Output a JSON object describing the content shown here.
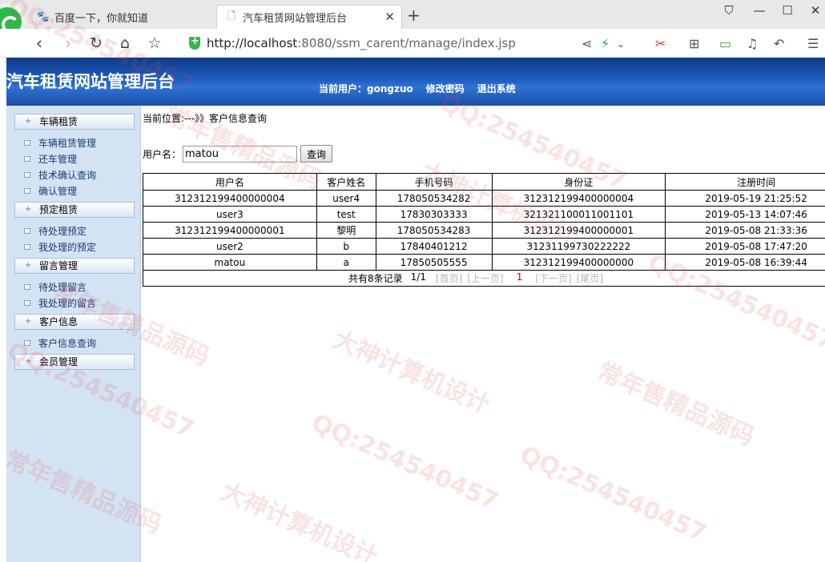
{
  "browser": {
    "tabs": [
      {
        "label": "百度一下，你就知道",
        "icon": "paw-icon"
      },
      {
        "label": "汽车租赁网站管理后台",
        "icon": "page-icon"
      }
    ],
    "url_host": "http://localhost",
    "url_path": ":8080/ssm_carent/manage/index.jsp"
  },
  "header": {
    "title": "汽车租赁网站管理后台",
    "current_user": "当前用户：gongzuo",
    "change_password": "修改密码",
    "logout": "退出系统"
  },
  "sidebar": {
    "categories": [
      {
        "label": "车辆租赁",
        "items": [
          "车辆租赁管理",
          "还车管理",
          "技术确认查询",
          "确认管理"
        ]
      },
      {
        "label": "预定租赁",
        "items": [
          "待处理预定",
          "我处理的预定"
        ]
      },
      {
        "label": "留言管理",
        "items": [
          "待处理留言",
          "我处理的留言"
        ]
      },
      {
        "label": "客户信息",
        "items": [
          "客户信息查询"
        ]
      },
      {
        "label": "会员管理",
        "items": []
      }
    ]
  },
  "main": {
    "breadcrumb": "当前位置:---》》客户信息查询",
    "search_label": "用户名：",
    "search_value": "matou",
    "search_button": "查询",
    "table": {
      "headers": [
        "用户名",
        "客户姓名",
        "手机号码",
        "身份证",
        "注册时间"
      ],
      "rows": [
        [
          "312312199400000004",
          "user4",
          "178050534282",
          "312312199400000004",
          "2019-05-19 21:25:52"
        ],
        [
          "user3",
          "test",
          "17830303333",
          "321321100011001101",
          "2019-05-13 14:07:46"
        ],
        [
          "312312199400000001",
          "黎明",
          "178050534283",
          "312312199400000001",
          "2019-05-08 21:33:36"
        ],
        [
          "user2",
          "b",
          "17840401212",
          "31231199730222222",
          "2019-05-08 17:47:20"
        ],
        [
          "matou",
          "a",
          "17850505555",
          "312312199400000000",
          "2019-05-08 16:39:44"
        ]
      ]
    },
    "pager": {
      "summary": "共有8条记录",
      "page": "1/1",
      "first": "[首页]",
      "prev": "[上一页]",
      "current": "1",
      "next": "[下一页]",
      "last": "[尾页]"
    }
  },
  "watermark": {
    "lines": [
      "QQ:254540457",
      "大神计算机设计",
      "常年售精品源码"
    ]
  }
}
